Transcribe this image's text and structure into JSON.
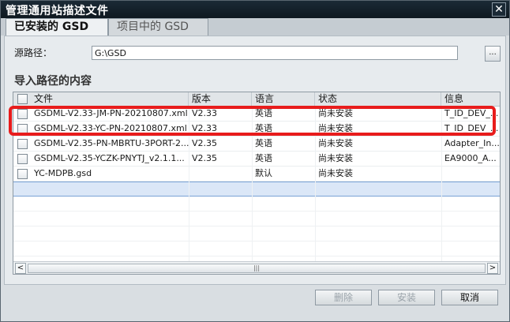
{
  "window": {
    "title": "管理通用站描述文件",
    "close_glyph": "✕"
  },
  "tabs": [
    {
      "label": "已安装的 GSD"
    },
    {
      "label": "项目中的 GSD"
    }
  ],
  "source": {
    "label": "源路径：",
    "value": "G:\\GSD",
    "browse_label": "..."
  },
  "section": {
    "title": "导入路径的内容"
  },
  "table": {
    "headers": [
      "文件",
      "版本",
      "语言",
      "状态",
      "信息"
    ],
    "rows": [
      {
        "file": "GSDML-V2.33-JM-PN-20210807.xml",
        "version": "V2.33",
        "language": "英语",
        "status": "尚未安装",
        "info": "T_ID_DEV_..."
      },
      {
        "file": "GSDML-V2.33-YC-PN-20210807.xml",
        "version": "V2.33",
        "language": "英语",
        "status": "尚未安装",
        "info": "T_ID_DEV_..."
      },
      {
        "file": "GSDML-V2.35-PN-MBRTU-3PORT-2...",
        "version": "V2.35",
        "language": "英语",
        "status": "尚未安装",
        "info": "Adapter_In..."
      },
      {
        "file": "GSDML-V2.35-YCZK-PNYTJ_v2.1.1...",
        "version": "V2.35",
        "language": "英语",
        "status": "尚未安装",
        "info": "EA9000_A..."
      },
      {
        "file": "YC-MDPB.gsd",
        "version": "",
        "language": "默认",
        "status": "尚未安装",
        "info": ""
      }
    ]
  },
  "scrollbar": {
    "left": "<",
    "right": ">",
    "grip": "|||"
  },
  "buttons": {
    "delete": "删除",
    "install": "安装",
    "cancel": "取消"
  }
}
